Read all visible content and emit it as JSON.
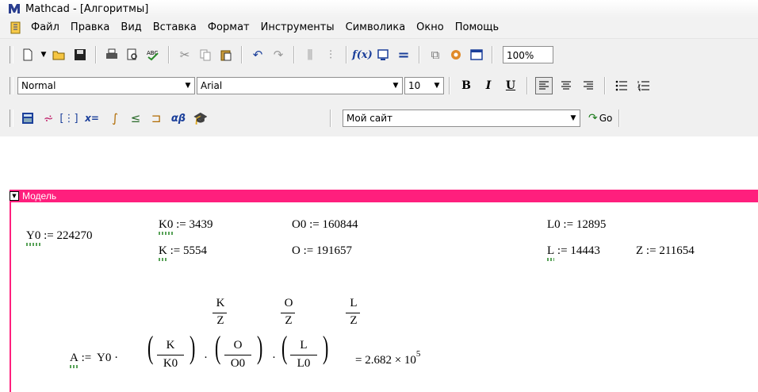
{
  "window": {
    "title": "Mathcad - [Алгоритмы]"
  },
  "menu": [
    "Файл",
    "Правка",
    "Вид",
    "Вставка",
    "Формат",
    "Инструменты",
    "Символика",
    "Окно",
    "Помощь"
  ],
  "toolbar": {
    "zoom": "100%"
  },
  "format_bar": {
    "style": "Normal",
    "font": "Arial",
    "size": "10",
    "bold": "B",
    "italic": "I",
    "underline": "U"
  },
  "web_bar": {
    "site": "Мой сайт",
    "go": "Go"
  },
  "region": {
    "title": "Модель"
  },
  "variables": {
    "y0": {
      "name": "Y0",
      "value": "224270"
    },
    "k0": {
      "name": "K0",
      "value": "3439"
    },
    "o0": {
      "name": "O0",
      "value": "160844"
    },
    "l0": {
      "name": "L0",
      "value": "12895"
    },
    "k": {
      "name": "K",
      "value": "5554"
    },
    "o": {
      "name": "O",
      "value": "191657"
    },
    "l": {
      "name": "L",
      "value": "14443"
    },
    "z": {
      "name": "Z",
      "value": "211654"
    }
  },
  "formula": {
    "lhs": "A",
    "assign": ":=",
    "factor": "Y0",
    "terms": [
      {
        "num": "K",
        "den": "K0",
        "exp_num": "K",
        "exp_den": "Z"
      },
      {
        "num": "O",
        "den": "O0",
        "exp_num": "O",
        "exp_den": "Z"
      },
      {
        "num": "L",
        "den": "L0",
        "exp_num": "L",
        "exp_den": "Z"
      }
    ],
    "result_mantissa": "= 2.682 × 10",
    "result_exp": "5"
  }
}
